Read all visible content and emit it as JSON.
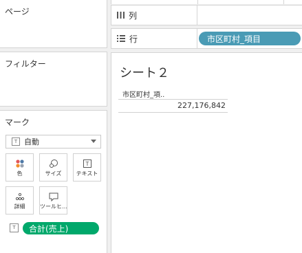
{
  "pages_card": {
    "title": "ページ"
  },
  "filters_card": {
    "title": "フィルター"
  },
  "columns_shelf": {
    "label": "列",
    "icon": "columns-icon"
  },
  "rows_shelf": {
    "label": "行",
    "icon": "rows-icon",
    "pill": "市区町村_項目"
  },
  "sheet": {
    "title": "シート２",
    "column_header": "市区町村_項..",
    "value": "227,176,842"
  },
  "marks_card": {
    "title": "マーク",
    "mark_type": "自動",
    "buttons": [
      {
        "label": "色",
        "icon": "color-icon"
      },
      {
        "label": "サイズ",
        "icon": "size-icon"
      },
      {
        "label": "テキスト",
        "icon": "text-icon"
      },
      {
        "label": "詳細",
        "icon": "detail-icon"
      },
      {
        "label": "ツールヒ…",
        "icon": "tooltip-icon"
      }
    ],
    "text_field_pill": "合計(売上)"
  },
  "colors": {
    "dimension_pill": "#4a9bb5",
    "measure_pill": "#00a86b"
  }
}
